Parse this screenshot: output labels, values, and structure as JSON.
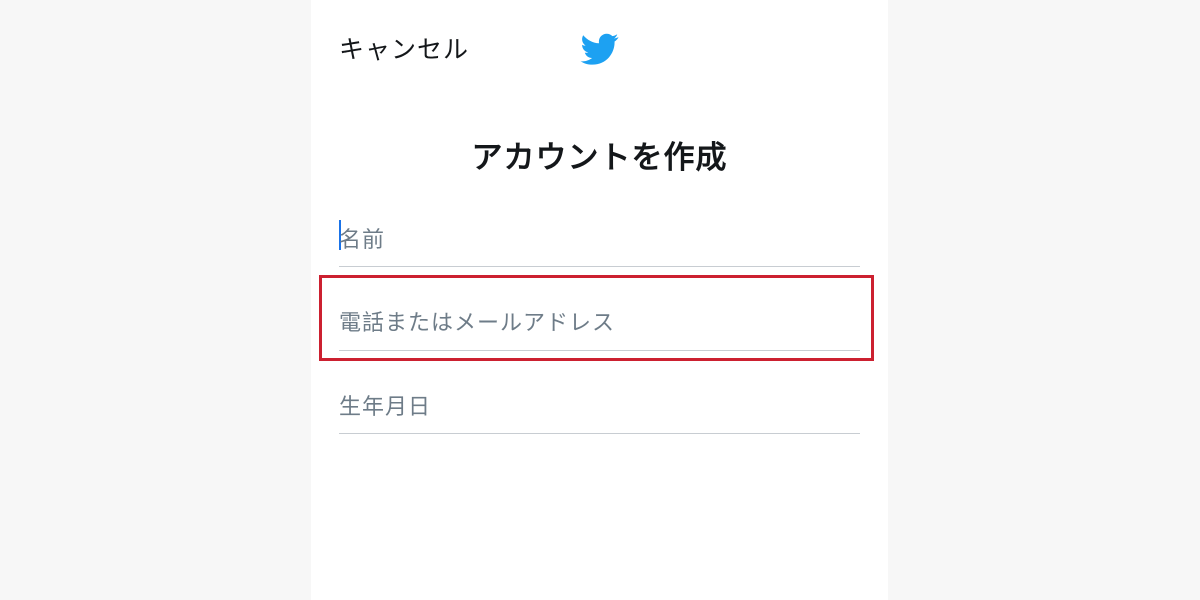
{
  "header": {
    "cancel_label": "キャンセル",
    "logo_icon": "twitter-bird-icon",
    "brand_color": "#1da1f2"
  },
  "form": {
    "title": "アカウントを作成",
    "name_placeholder": "名前",
    "contact_placeholder": "電話またはメールアドレス",
    "birthdate_placeholder": "生年月日"
  },
  "annotation": {
    "highlight_color": "#cc2030"
  }
}
